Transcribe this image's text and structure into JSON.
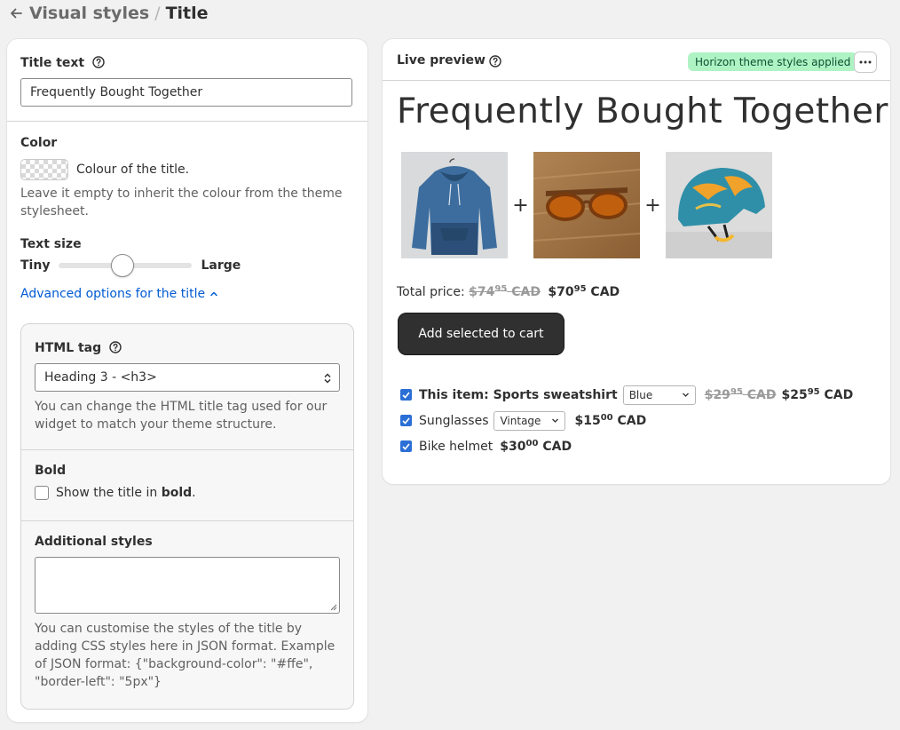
{
  "breadcrumb": {
    "parent": "Visual styles",
    "separator": "/",
    "current": "Title"
  },
  "settings": {
    "title_text": {
      "label": "Title text",
      "value": "Frequently Bought Together"
    },
    "color": {
      "label": "Color",
      "swatch_caption": "Colour of the title.",
      "help": "Leave it empty to inherit the colour from the theme stylesheet."
    },
    "text_size": {
      "label": "Text size",
      "min_label": "Tiny",
      "max_label": "Large",
      "level_fraction": 0.47
    },
    "advanced_link": "Advanced options for the title",
    "html_tag": {
      "label": "HTML tag",
      "value": "Heading 3 - <h3>",
      "help": "You can change the HTML title tag used for our widget to match your theme structure."
    },
    "bold": {
      "label": "Bold",
      "checkbox_text_prefix": "Show the title in ",
      "checkbox_text_bold": "bold",
      "checkbox_text_suffix": ".",
      "checked": false
    },
    "additional_styles": {
      "label": "Additional styles",
      "value": "",
      "help": "You can customise the styles of the title by adding CSS styles here in JSON format. Example of JSON format: {\"background-color\": \"#ffe\", \"border-left\": \"5px\"}"
    }
  },
  "preview": {
    "label": "Live preview",
    "badge": "Horizon theme styles applied",
    "title": "Frequently Bought Together",
    "products": [
      {
        "image": "blue-hoodie"
      },
      {
        "image": "sunglasses"
      },
      {
        "image": "bike-helmet"
      }
    ],
    "plus": "+",
    "total": {
      "label": "Total price:",
      "old_main": "$74",
      "old_cents": "95",
      "old_currency": "CAD",
      "new_main": "$70",
      "new_cents": "95",
      "new_currency": "CAD"
    },
    "cart_button": "Add selected to cart",
    "items": [
      {
        "name": "This item: Sports sweatshirt",
        "variant": "Blue",
        "old_main": "$29",
        "old_cents": "95",
        "old_currency": "CAD",
        "price_main": "$25",
        "price_cents": "95",
        "currency": "CAD"
      },
      {
        "name": "Sunglasses",
        "variant": "Vintage",
        "price_main": "$15",
        "price_cents": "00",
        "currency": "CAD"
      },
      {
        "name": "Bike helmet",
        "price_main": "$30",
        "price_cents": "00",
        "currency": "CAD"
      }
    ]
  },
  "colors": {
    "accent": "#005bd3",
    "badge_bg": "#aff3c4",
    "button_bg": "#303030",
    "checkbox": "#2b6fd6"
  }
}
